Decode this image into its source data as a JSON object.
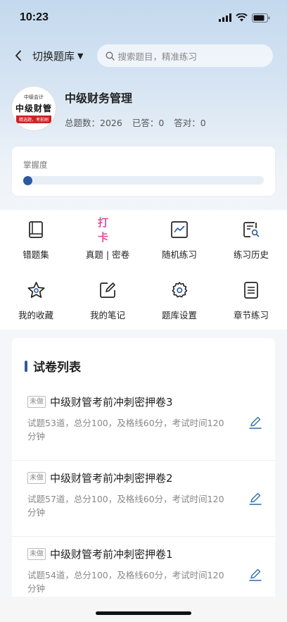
{
  "status_bar": {
    "time": "10:23"
  },
  "nav": {
    "switch_label": "切换题库",
    "search_placeholder": "搜索题目，精准练习"
  },
  "book": {
    "cover_top": "中级会计",
    "cover_main": "中级财管",
    "cover_band": "精选题，考前刷",
    "title": "中级财务管理",
    "stats": {
      "total": "总题数：2026",
      "answered": "已答：0",
      "correct": "答对：0"
    }
  },
  "mastery": {
    "label": "掌握度",
    "value": 0
  },
  "features": [
    {
      "label": "错题集",
      "icon": "book-icon"
    },
    {
      "label": "真题 | 密卷",
      "icon": "checkin-badge",
      "badge": "打卡"
    },
    {
      "label": "随机练习",
      "icon": "trend-chart-icon"
    },
    {
      "label": "练习历史",
      "icon": "document-search-icon"
    },
    {
      "label": "我的收藏",
      "icon": "star-icon"
    },
    {
      "label": "我的笔记",
      "icon": "edit-note-icon"
    },
    {
      "label": "题库设置",
      "icon": "gear-icon"
    },
    {
      "label": "章节练习",
      "icon": "list-document-icon"
    }
  ],
  "papers": {
    "section_title": "试卷列表",
    "items": [
      {
        "badge": "未做",
        "title": "中级财管考前冲刺密押卷3",
        "meta": "试题53道，总分100，及格线60分，考试时间120分钟"
      },
      {
        "badge": "未做",
        "title": "中级财管考前冲刺密押卷2",
        "meta": "试题57道，总分100，及格线60分，考试时间120分钟"
      },
      {
        "badge": "未做",
        "title": "中级财管考前冲刺密押卷1",
        "meta": "试题54道，总分100，及格线60分，考试时间120分钟"
      }
    ]
  },
  "colors": {
    "accent": "#2c5aa0",
    "checkin": "#e0539a"
  }
}
